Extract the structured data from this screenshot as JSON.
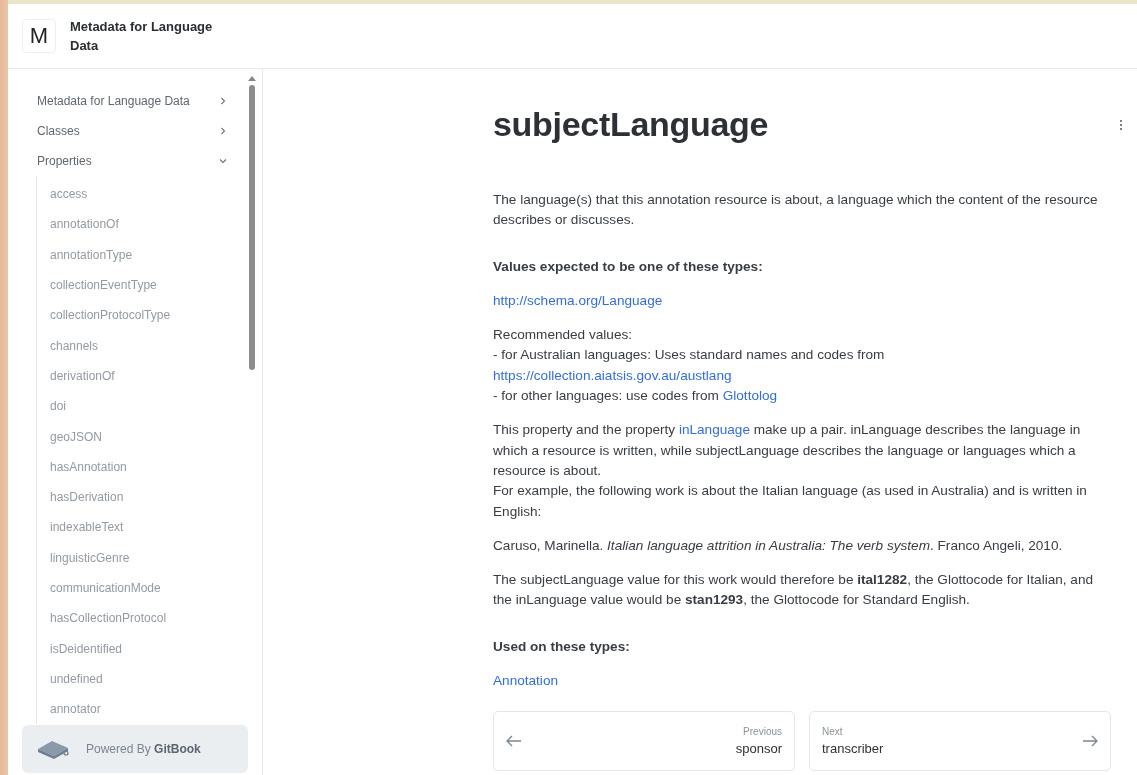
{
  "site": {
    "logo_letter": "M",
    "title": "Metadata for Language Data"
  },
  "sidebar": {
    "items": [
      {
        "label": "Metadata for Language Data",
        "expanded": false
      },
      {
        "label": "Classes",
        "expanded": false
      },
      {
        "label": "Properties",
        "expanded": true,
        "children": [
          {
            "label": "access"
          },
          {
            "label": "annotationOf"
          },
          {
            "label": "annotationType"
          },
          {
            "label": "collectionEventType"
          },
          {
            "label": "collectionProtocolType"
          },
          {
            "label": "channels"
          },
          {
            "label": "derivationOf"
          },
          {
            "label": "doi"
          },
          {
            "label": "geoJSON"
          },
          {
            "label": "hasAnnotation"
          },
          {
            "label": "hasDerivation"
          },
          {
            "label": "indexableText"
          },
          {
            "label": "linguisticGenre"
          },
          {
            "label": "communicationMode"
          },
          {
            "label": "hasCollectionProtocol"
          },
          {
            "label": "isDeidentified"
          },
          {
            "label": "undefined"
          },
          {
            "label": "annotator"
          }
        ]
      }
    ],
    "footer": "Powered By **GitBook**"
  },
  "page": {
    "title": "subjectLanguage",
    "blocks": [
      {
        "kind": "paragraph",
        "lines": [
          [
            {
              "kind": "text",
              "text": "The language(s) that this annotation resource is about, a language which the content of the resource describes or discusses."
            }
          ]
        ]
      },
      {
        "kind": "heading",
        "lines": [
          [
            {
              "kind": "text",
              "text": "Values expected to be one of these types:"
            }
          ]
        ]
      },
      {
        "kind": "paragraph",
        "lines": [
          [
            {
              "kind": "link",
              "text": "http://schema.org/Language"
            }
          ]
        ]
      },
      {
        "kind": "paragraph",
        "lines": [
          [
            {
              "kind": "text",
              "text": "Recommended values:"
            }
          ],
          [
            {
              "kind": "text",
              "text": "- for Australian languages: Uses standard names and codes from"
            }
          ],
          [
            {
              "kind": "link",
              "text": "https://collection.aiatsis.gov.au/austlang"
            }
          ],
          [
            {
              "kind": "text",
              "text": "- for other languages: use codes from "
            },
            {
              "kind": "link",
              "text": "Glottolog"
            }
          ]
        ]
      },
      {
        "kind": "paragraph",
        "lines": [
          [
            {
              "kind": "text",
              "text": "This property and the property "
            },
            {
              "kind": "link",
              "text": "inLanguage"
            },
            {
              "kind": "text",
              "text": " make up a pair. inLanguage describes the language in which a resource is written, while subjectLanguage describes the language or languages which a resource is about."
            }
          ],
          [
            {
              "kind": "text",
              "text": "For example, the following work is about the Italian language (as used in Australia) and is written in English:"
            }
          ]
        ]
      },
      {
        "kind": "paragraph",
        "lines": [
          [
            {
              "kind": "text",
              "text": "Caruso, Marinella. *Italian language attrition in Australia: The verb system*. Franco Angeli, 2010."
            }
          ]
        ]
      },
      {
        "kind": "paragraph",
        "lines": [
          [
            {
              "kind": "text",
              "text": "The subjectLanguage value for this work would therefore be **ital1282**, the Glottocode for Italian, and the inLanguage value would be **stan1293**, the Glottocode for Standard English."
            }
          ]
        ]
      },
      {
        "kind": "heading",
        "lines": [
          [
            {
              "kind": "text",
              "text": "Used on these types:"
            }
          ]
        ]
      },
      {
        "kind": "paragraph",
        "lines": [
          [
            {
              "kind": "link",
              "text": "Annotation"
            }
          ]
        ]
      }
    ],
    "pager": {
      "previous": {
        "caption": "Previous",
        "title": "sponsor"
      },
      "next": {
        "caption": "Next",
        "title": "transcriber"
      }
    }
  }
}
